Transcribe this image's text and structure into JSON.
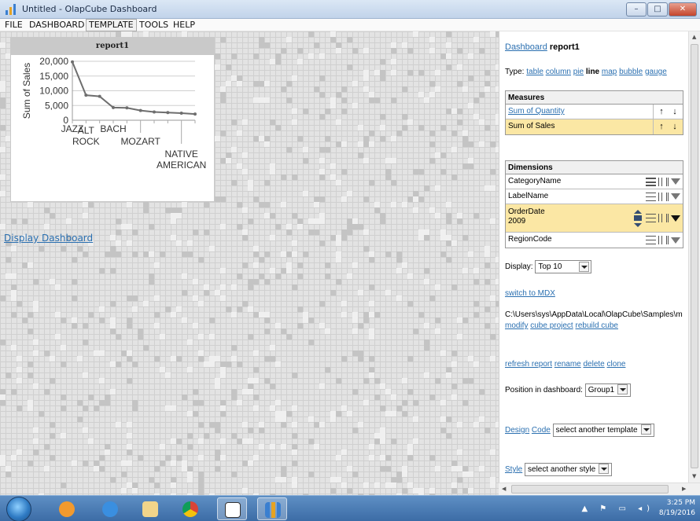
{
  "window": {
    "title": "Untitled - OlapCube Dashboard",
    "minimize": "–",
    "maximize": "□",
    "close": "✕"
  },
  "menu": [
    "FILE",
    "DASHBOARD",
    "TEMPLATE",
    "TOOLS",
    "HELP"
  ],
  "report": {
    "title": "report1",
    "chart_data": {
      "type": "line",
      "title": "report1",
      "ylabel": "Sum of Sales",
      "xlabel": "",
      "ylim": [
        0,
        20000
      ],
      "yticks": [
        "20,000",
        "15,000",
        "10,000",
        "5,000",
        "0"
      ],
      "grid": true,
      "categories": [
        "JAZZ",
        "ALT ROCK",
        "",
        "BACH",
        "",
        "MOZART",
        "",
        "",
        "NATIVE AMERICAN",
        ""
      ],
      "x_tick_labels": [
        "JAZZ",
        "ALT",
        "ROCK",
        "BACH",
        "MOZART",
        "NATIVE",
        "AMERICAN"
      ],
      "series": [
        {
          "values": [
            19800,
            8500,
            8100,
            4300,
            4200,
            3300,
            2800,
            2600,
            2400,
            2100
          ]
        }
      ],
      "color": "#6e6e6e"
    }
  },
  "display_dashboard": "Display Dashboard",
  "panel": {
    "breadcrumb_link": "Dashboard",
    "report_name": "report1",
    "type_label": "Type:",
    "types": [
      "table",
      "column",
      "pie",
      "line",
      "map",
      "bubble",
      "gauge"
    ],
    "selected_type": "line",
    "measures_header": "Measures",
    "measures": [
      "Sum of Quantity",
      "Sum of Sales"
    ],
    "up_arrow": "↑",
    "down_arrow": "↓",
    "dimensions_header": "Dimensions",
    "dimensions": [
      "CategoryName",
      "LabelName",
      "OrderDate",
      "RegionCode"
    ],
    "orderdate_value": "2009",
    "display_label": "Display:",
    "display_value": "Top 10",
    "switch_mdx": "switch to MDX",
    "path": "C:\\Users\\sys\\AppData\\Local\\OlapCube\\Samples\\m",
    "modify": "modify",
    "cube_project": "cube project",
    "rebuild_cube": "rebuild cube",
    "refresh_report": "refresh report",
    "rename": "rename",
    "delete": "delete",
    "clone": "clone",
    "position_label": "Position in dashboard:",
    "position_value": "Group1",
    "design": "Design",
    "code": "Code",
    "template_select": "select another template",
    "style_link": "Style",
    "style_select": "select another style"
  },
  "tray": {
    "time": "3:25 PM",
    "date": "8/19/2016"
  }
}
